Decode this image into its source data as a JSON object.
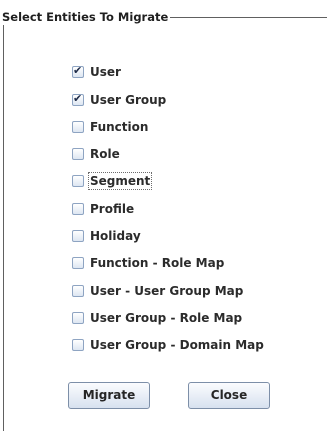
{
  "group_box": {
    "title": "Select Entities To Migrate"
  },
  "entities": [
    {
      "label": "User",
      "checked": true
    },
    {
      "label": "User Group",
      "checked": true
    },
    {
      "label": "Function",
      "checked": false
    },
    {
      "label": "Role",
      "checked": false
    },
    {
      "label": "Segment",
      "checked": false,
      "focused": true
    },
    {
      "label": "Profile",
      "checked": false
    },
    {
      "label": "Holiday",
      "checked": false
    },
    {
      "label": "Function - Role Map",
      "checked": false
    },
    {
      "label": "User - User Group Map",
      "checked": false
    },
    {
      "label": "User Group - Role Map",
      "checked": false
    },
    {
      "label": "User Group - Domain Map",
      "checked": false
    }
  ],
  "buttons": {
    "migrate_label": "Migrate",
    "close_label": "Close"
  },
  "colors": {
    "checkbox_border": "#8ea4c2",
    "check_mark": "#1d2a47",
    "button_border": "#7d8fa8"
  }
}
